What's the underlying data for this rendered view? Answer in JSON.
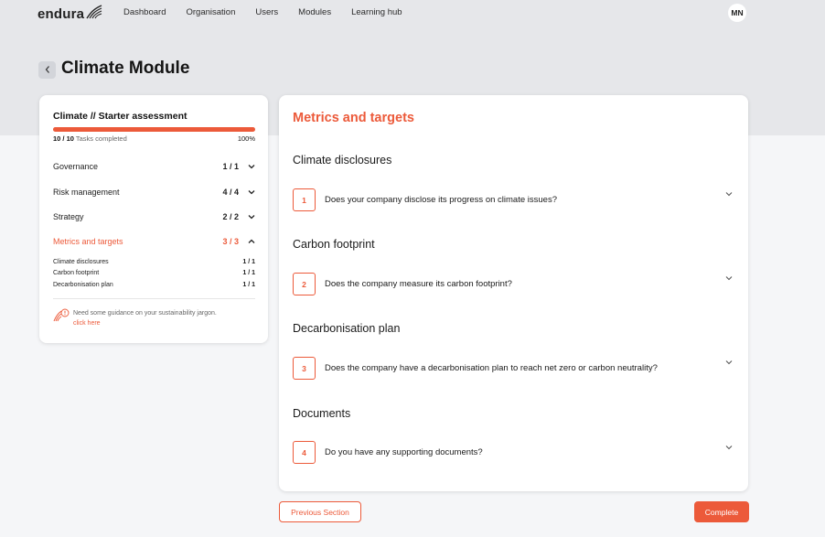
{
  "header": {
    "logo_text": "endura",
    "nav": [
      "Dashboard",
      "Organisation",
      "Users",
      "Modules",
      "Learning hub"
    ],
    "avatar_initials": "MN"
  },
  "page": {
    "title": "Climate Module"
  },
  "assessment": {
    "title": "Climate // Starter assessment",
    "progress_fraction": 1.0,
    "tasks_done": "10 / 10",
    "tasks_label": "Tasks completed",
    "percent": "100%",
    "sections": [
      {
        "label": "Governance",
        "count": "1 / 1",
        "expanded": false
      },
      {
        "label": "Risk management",
        "count": "4 / 4",
        "expanded": false
      },
      {
        "label": "Strategy",
        "count": "2 / 2",
        "expanded": false
      },
      {
        "label": "Metrics and targets",
        "count": "3 / 3",
        "expanded": true
      }
    ],
    "subsections": [
      {
        "label": "Climate disclosures",
        "count": "1 / 1"
      },
      {
        "label": "Carbon footprint",
        "count": "1 / 1"
      },
      {
        "label": "Decarbonisation plan",
        "count": "1 / 1"
      }
    ],
    "guidance_text": "Need some guidance on your sustainability jargon.",
    "guidance_link": "click here"
  },
  "main": {
    "title": "Metrics and targets",
    "groups": [
      {
        "title": "Climate disclosures",
        "number": "1",
        "question": "Does your company disclose its progress on climate issues?"
      },
      {
        "title": "Carbon footprint",
        "number": "2",
        "question": "Does the company measure its carbon footprint?"
      },
      {
        "title": "Decarbonisation plan",
        "number": "3",
        "question": "Does the company have a decarbonisation plan to reach net zero or carbon neutrality?"
      },
      {
        "title": "Documents",
        "number": "4",
        "question": "Do you have any supporting documents?"
      }
    ]
  },
  "footer": {
    "prev_label": "Previous Section",
    "complete_label": "Complete"
  },
  "colors": {
    "accent": "#ec5a3a",
    "band": "#e6e7ea"
  }
}
